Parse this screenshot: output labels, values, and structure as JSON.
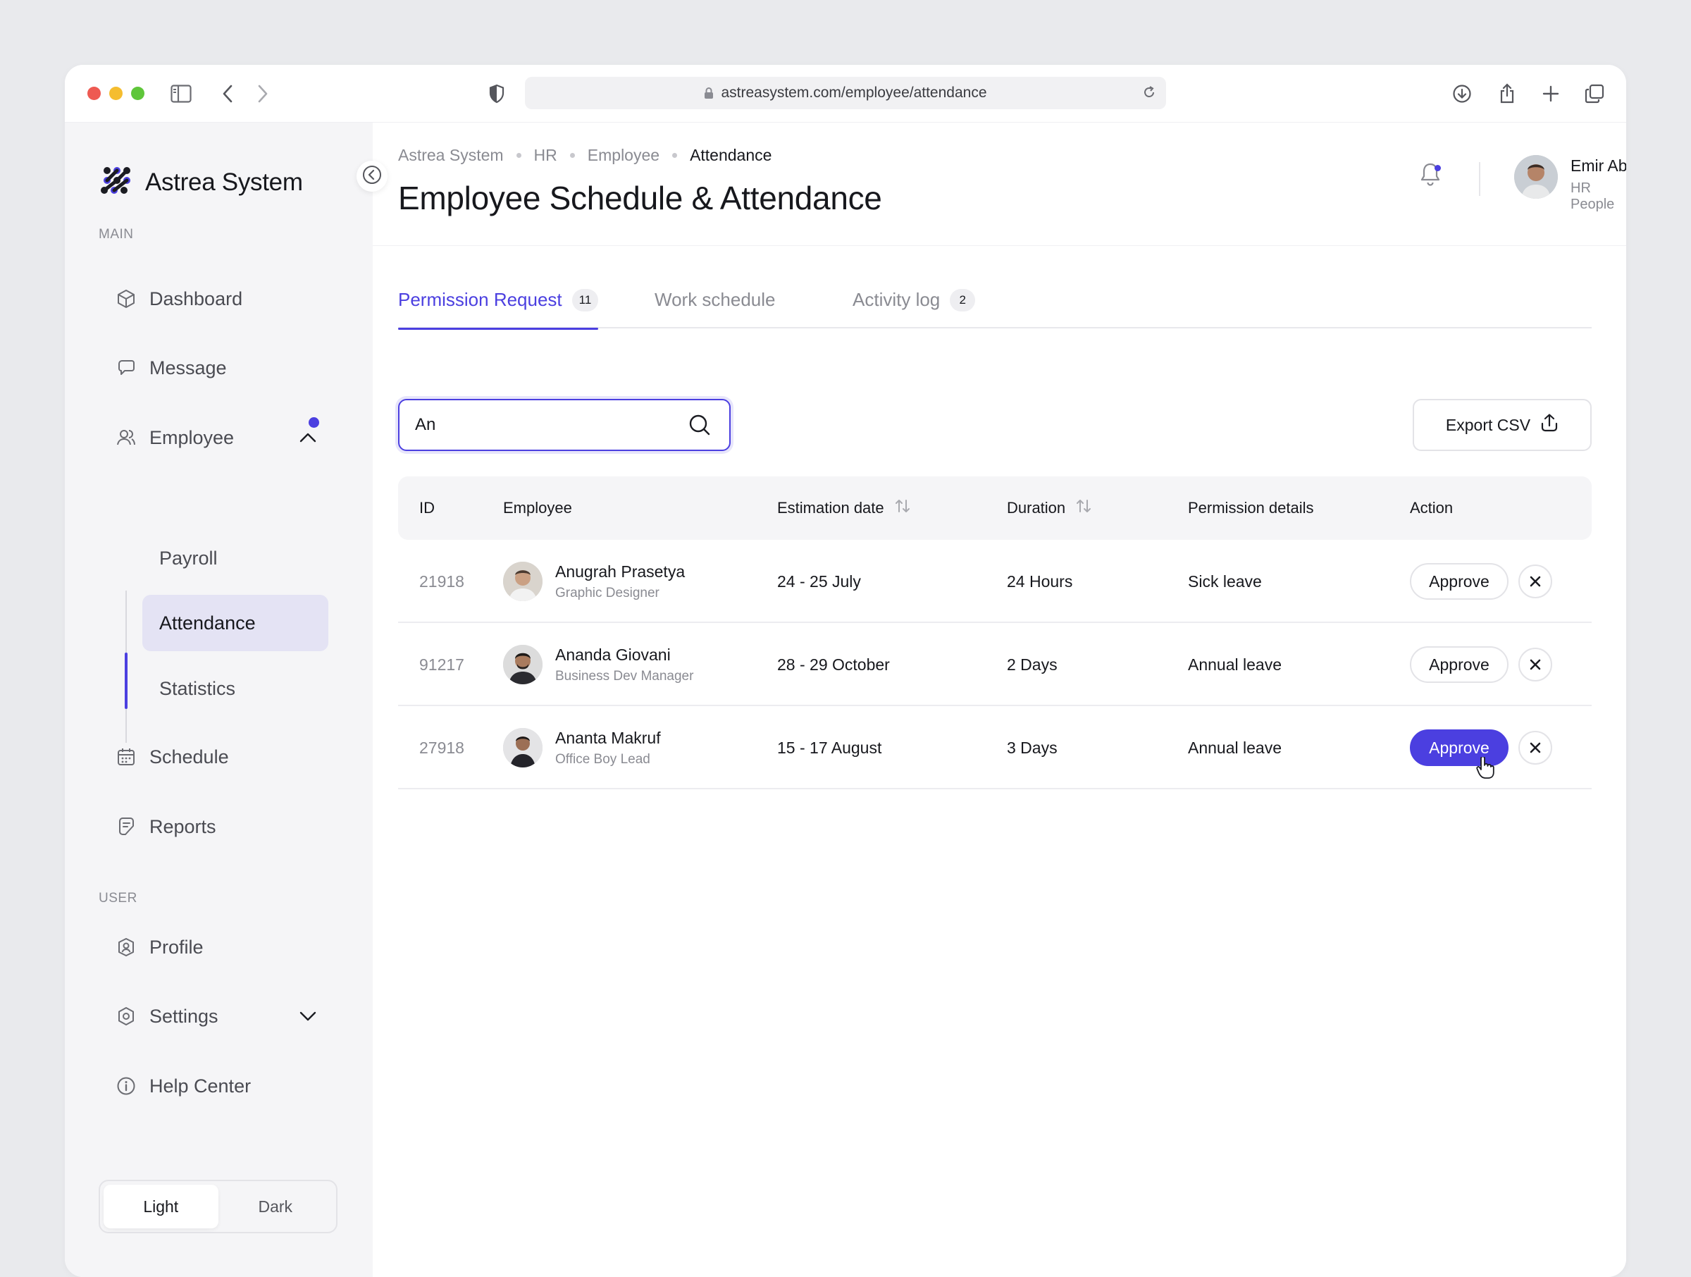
{
  "browser": {
    "url": "astreasystem.com/employee/attendance"
  },
  "brand": {
    "name": "Astrea System",
    "accent": "#4b3fe0"
  },
  "sidebar": {
    "main_label": "MAIN",
    "user_label": "USER",
    "items": {
      "dashboard": "Dashboard",
      "message": "Message",
      "employee": "Employee",
      "payroll": "Payroll",
      "attendance": "Attendance",
      "statistics": "Statistics",
      "schedule": "Schedule",
      "reports": "Reports",
      "profile": "Profile",
      "settings": "Settings",
      "help": "Help Center"
    },
    "theme": {
      "light": "Light",
      "dark": "Dark",
      "selected": "Light"
    }
  },
  "header": {
    "breadcrumb": [
      "Astrea System",
      "HR",
      "Employee",
      "Attendance"
    ],
    "title": "Employee Schedule & Attendance",
    "user": {
      "name": "Emir Abiyyu",
      "role": "HR People"
    }
  },
  "tabs": [
    {
      "label": "Permission Request",
      "badge": "11",
      "active": true
    },
    {
      "label": "Work schedule",
      "badge": "",
      "active": false
    },
    {
      "label": "Activity log",
      "badge": "2",
      "active": false
    }
  ],
  "search": {
    "value": "An"
  },
  "export_label": "Export CSV",
  "table": {
    "columns": [
      "ID",
      "Employee",
      "Estimation date",
      "Duration",
      "Permission details",
      "Action"
    ],
    "rows": [
      {
        "id": "21918",
        "name": "Anugrah Prasetya",
        "role": "Graphic Designer",
        "date": "24 - 25 July",
        "duration": "24 Hours",
        "details": "Sick leave",
        "action": "Approve"
      },
      {
        "id": "91217",
        "name": "Ananda Giovani",
        "role": "Business Dev Manager",
        "date": "28 - 29 October",
        "duration": "2 Days",
        "details": "Annual leave",
        "action": "Approve"
      },
      {
        "id": "27918",
        "name": "Ananta Makruf",
        "role": "Office Boy Lead",
        "date": "15 - 17 August",
        "duration": "3 Days",
        "details": "Annual leave",
        "action": "Approve"
      }
    ]
  }
}
